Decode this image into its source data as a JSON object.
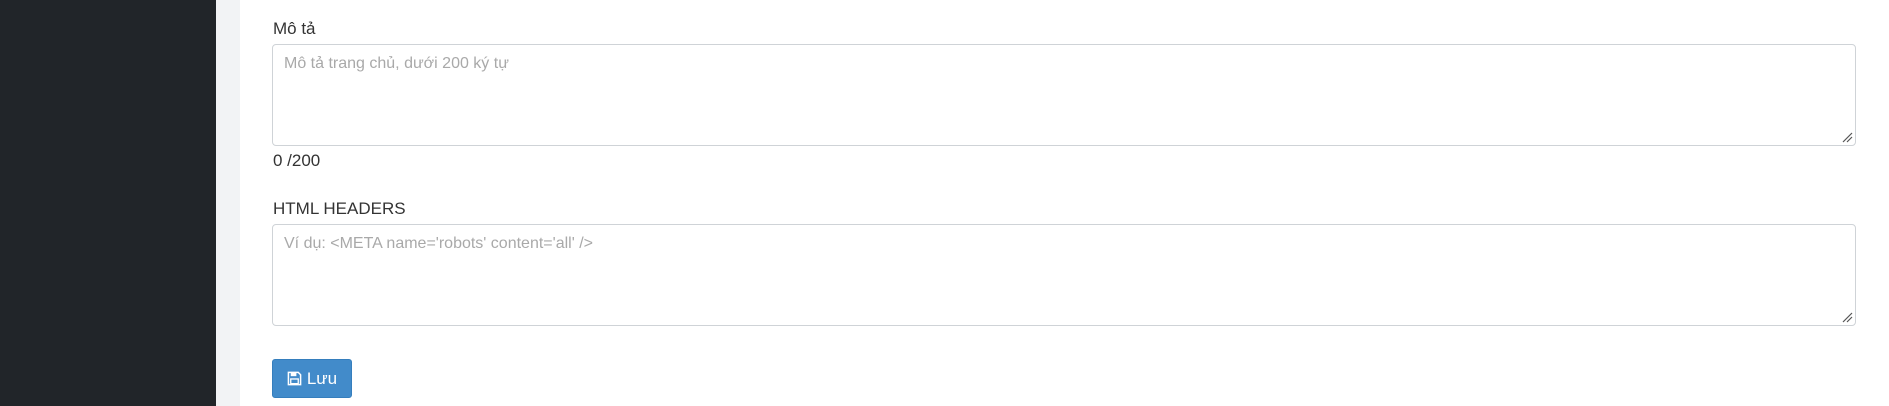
{
  "description_field": {
    "label": "Mô tả",
    "placeholder": "Mô tả trang chủ, dưới 200 ký tự",
    "value": "",
    "counter": "0 /200"
  },
  "html_headers_field": {
    "label": "HTML HEADERS",
    "placeholder": "Ví dụ: <META name='robots' content='all' />",
    "value": ""
  },
  "save_button": {
    "label": "Lưu",
    "icon": "floppy-disk-icon"
  },
  "colors": {
    "sidebar": "#212529",
    "button": "#428bca",
    "background": "#f2f3f5"
  }
}
